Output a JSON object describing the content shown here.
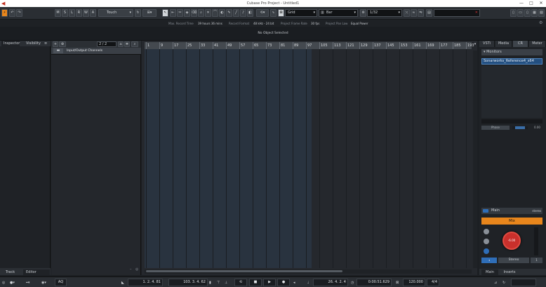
{
  "window": {
    "title": "Cubase Pro Project - Untitled1",
    "minimize": "—",
    "maximize": "□",
    "close": "✕"
  },
  "toolbar": {
    "m": "M",
    "s": "S",
    "l": "L",
    "r": "R",
    "w": "W",
    "a": "A",
    "automation_mode": "Touch",
    "snap_type": "Grid",
    "grid_type": "Bar",
    "quantize": "1/32"
  },
  "infoline": {
    "max_record_time_label": "Max. Record Time",
    "max_record_time": "39 hours 36 mins",
    "record_format_label": "Record Format",
    "record_format": "48 kHz - 24 bit",
    "frame_rate_label": "Project Frame Rate",
    "frame_rate": "30 fps",
    "pan_law_label": "Project Pan Law",
    "pan_law": "Equal Power"
  },
  "selection": {
    "text": "No Object Selected"
  },
  "inspector": {
    "tab_inspector": "Inspector",
    "tab_visibility": "Visibility",
    "bottom_track": "Track",
    "bottom_editor": "Editor"
  },
  "tracklist": {
    "counter": "2 / 2",
    "folder": "Input/Output Channels"
  },
  "ruler": {
    "labels": [
      "1",
      "9",
      "17",
      "25",
      "33",
      "41",
      "49",
      "57",
      "65",
      "73",
      "81",
      "89",
      "97",
      "105",
      "113",
      "121",
      "129",
      "137",
      "145",
      "153",
      "161",
      "169",
      "177",
      "185",
      "193"
    ]
  },
  "right": {
    "tabs": [
      "VSTi",
      "Media",
      "CR",
      "Meter"
    ],
    "monitors_header": "Monitors",
    "monitor_item": "Sonarworks_Reference4_x64",
    "phase_label": "Phase",
    "phase_value": "0.00",
    "main_label": "Main",
    "stereo_label": "stereo",
    "mix_label": "Mix",
    "volume_value": "-6.00",
    "stereo_button": "Stereo",
    "bottom_main": "Main",
    "bottom_inserts": "Inserts"
  },
  "transport": {
    "left_locator": "1. 2. 4. 81",
    "right_locator": "103. 3. 4. 62",
    "position_bars": "26. 4. 2. 4",
    "position_time": "0:00:51.629",
    "tempo": "120.000",
    "signature": "4/4",
    "aq_label": "AQ"
  }
}
